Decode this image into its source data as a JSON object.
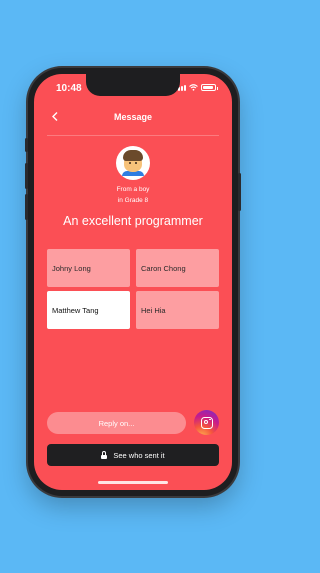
{
  "status_bar": {
    "time": "10:48",
    "battery_level": 0.9
  },
  "nav": {
    "back_icon": "chevron-left-icon",
    "title": "Message"
  },
  "sender": {
    "avatar_icon": "boy-emoji-icon",
    "line1": "From a boy",
    "line2": "in Grade 8"
  },
  "question": "An excellent programmer",
  "options": [
    {
      "label": "Johny Long",
      "selected": false
    },
    {
      "label": "Caron Chong",
      "selected": false
    },
    {
      "label": "Matthew Tang",
      "selected": true
    },
    {
      "label": "Hei Hia",
      "selected": false
    }
  ],
  "reply": {
    "placeholder": "Reply on..."
  },
  "share": {
    "icon": "instagram-icon"
  },
  "reveal": {
    "icon": "lock-icon",
    "label": "See who sent it"
  },
  "colors": {
    "background": "#5bb8f5",
    "screen": "#fb4f55",
    "button_dark": "#1f1f21"
  }
}
